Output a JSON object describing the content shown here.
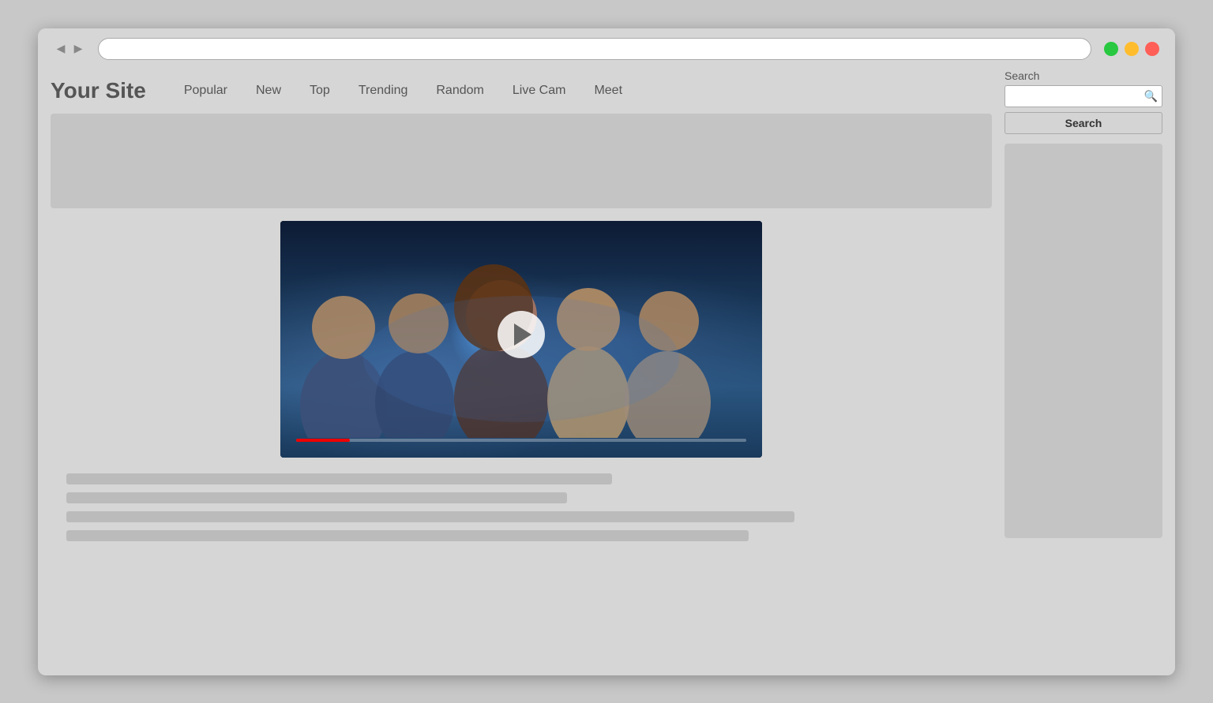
{
  "browser": {
    "back_arrow": "◀",
    "forward_arrow": "▶"
  },
  "window_controls": {
    "green": "green",
    "yellow": "yellow",
    "red": "red"
  },
  "site": {
    "logo": "Your Site",
    "nav": [
      {
        "label": "Popular",
        "id": "popular"
      },
      {
        "label": "New",
        "id": "new"
      },
      {
        "label": "Top",
        "id": "top"
      },
      {
        "label": "Trending",
        "id": "trending"
      },
      {
        "label": "Random",
        "id": "random"
      },
      {
        "label": "Live Cam",
        "id": "livecam"
      },
      {
        "label": "Meet",
        "id": "meet"
      }
    ]
  },
  "search": {
    "label": "Search",
    "placeholder": "",
    "button_label": "Search"
  },
  "video": {
    "play_label": "Play"
  }
}
